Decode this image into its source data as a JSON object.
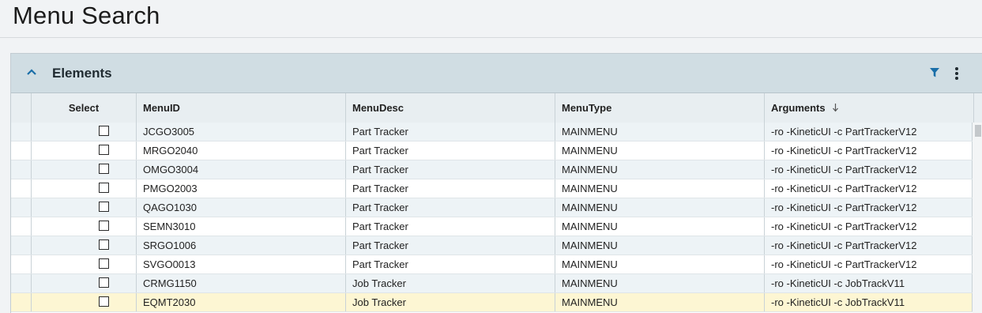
{
  "page": {
    "title": "Menu Search"
  },
  "panel": {
    "title": "Elements"
  },
  "columns": {
    "select": "Select",
    "menuid": "MenuID",
    "menudesc": "MenuDesc",
    "menutype": "MenuType",
    "arguments": "Arguments"
  },
  "sort": {
    "column": "Arguments",
    "direction": "descending"
  },
  "rows": [
    {
      "menuid": "JCGO3005",
      "menudesc": "Part Tracker",
      "menutype": "MAINMENU",
      "arguments": "-ro -KineticUI -c PartTrackerV12",
      "selected": false
    },
    {
      "menuid": "MRGO2040",
      "menudesc": "Part Tracker",
      "menutype": "MAINMENU",
      "arguments": "-ro -KineticUI -c PartTrackerV12",
      "selected": false
    },
    {
      "menuid": "OMGO3004",
      "menudesc": "Part Tracker",
      "menutype": "MAINMENU",
      "arguments": "-ro -KineticUI -c PartTrackerV12",
      "selected": false
    },
    {
      "menuid": "PMGO2003",
      "menudesc": "Part Tracker",
      "menutype": "MAINMENU",
      "arguments": "-ro -KineticUI -c PartTrackerV12",
      "selected": false
    },
    {
      "menuid": "QAGO1030",
      "menudesc": "Part Tracker",
      "menutype": "MAINMENU",
      "arguments": "-ro -KineticUI -c PartTrackerV12",
      "selected": false
    },
    {
      "menuid": "SEMN3010",
      "menudesc": "Part Tracker",
      "menutype": "MAINMENU",
      "arguments": "-ro -KineticUI -c PartTrackerV12",
      "selected": false
    },
    {
      "menuid": "SRGO1006",
      "menudesc": "Part Tracker",
      "menutype": "MAINMENU",
      "arguments": "-ro -KineticUI -c PartTrackerV12",
      "selected": false
    },
    {
      "menuid": "SVGO0013",
      "menudesc": "Part Tracker",
      "menutype": "MAINMENU",
      "arguments": "-ro -KineticUI -c PartTrackerV12",
      "selected": false
    },
    {
      "menuid": "CRMG1150",
      "menudesc": "Job Tracker",
      "menutype": "MAINMENU",
      "arguments": "-ro -KineticUI -c JobTrackV11",
      "selected": false
    },
    {
      "menuid": "EQMT2030",
      "menudesc": "Job Tracker",
      "menutype": "MAINMENU",
      "arguments": "-ro -KineticUI -c JobTrackV11",
      "selected": false,
      "highlighted": true
    }
  ],
  "colors": {
    "accent": "#1a6ea8",
    "header_bg": "#d0dde3",
    "row_highlight": "#fdf6d3"
  },
  "icons": {
    "collapse": "chevron-up-icon",
    "filter": "filter-icon",
    "more": "kebab-menu-icon",
    "sort": "arrow-down-icon"
  }
}
